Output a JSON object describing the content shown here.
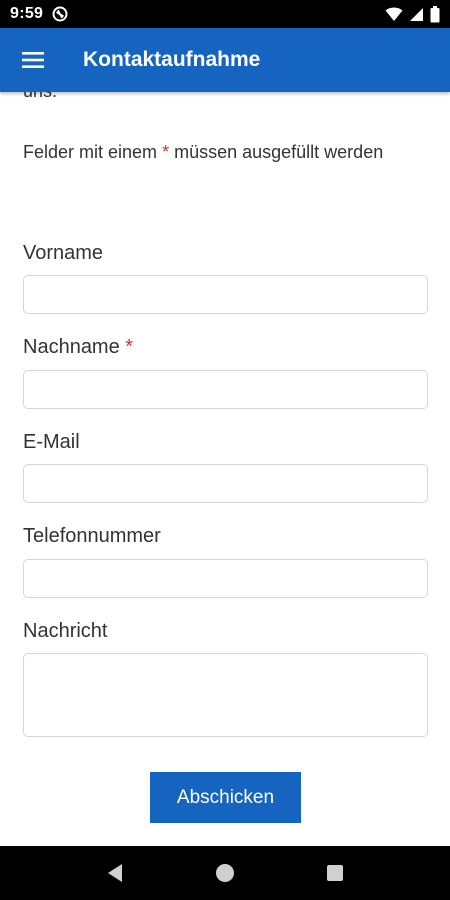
{
  "status_bar": {
    "time": "9:59",
    "icons": [
      "do-not-disturb-icon",
      "wifi-icon",
      "signal-icon",
      "battery-icon"
    ]
  },
  "app_bar": {
    "title": "Kontaktaufnahme",
    "menu_icon": "hamburger-menu-icon",
    "color": "#1565c0"
  },
  "form": {
    "intro_fragment": "uns.",
    "required_note_before": "Felder mit einem",
    "required_marker": "*",
    "required_note_after": "müssen ausgefüllt werden",
    "fields": [
      {
        "label": "Vorname",
        "required": false,
        "value": ""
      },
      {
        "label": "Nachname",
        "required": true,
        "required_marker": "*",
        "value": ""
      },
      {
        "label": "E-Mail",
        "required": false,
        "value": ""
      },
      {
        "label": "Telefonnummer",
        "required": false,
        "value": ""
      },
      {
        "label": "Nachricht",
        "required": false,
        "value": "",
        "multiline": true
      }
    ],
    "submit_label": "Abschicken",
    "accent_color": "#1565c0",
    "required_color": "#d32f2f"
  },
  "nav_bar": {
    "buttons": [
      "back-icon",
      "home-icon",
      "recents-icon"
    ]
  }
}
